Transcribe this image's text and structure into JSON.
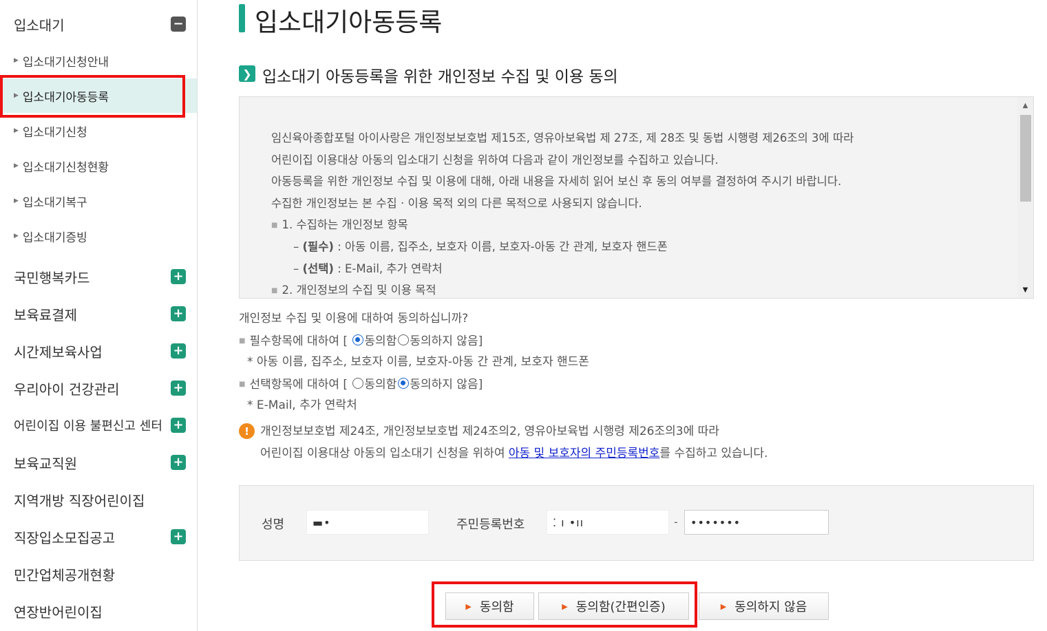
{
  "sidebar": {
    "waitlist": {
      "header": "입소대기",
      "items": [
        "입소대기신청안내",
        "입소대기아동등록",
        "입소대기신청",
        "입소대기신청현황",
        "입소대기복구",
        "입소대기증빙"
      ]
    },
    "sections": [
      {
        "label": "국민행복카드",
        "toggle": "+"
      },
      {
        "label": "보육료결제",
        "toggle": "+"
      },
      {
        "label": "시간제보육사업",
        "toggle": "+"
      },
      {
        "label": "우리아이 건강관리",
        "toggle": "+"
      },
      {
        "label": "어린이집 이용 불편신고 센터",
        "toggle": "+"
      },
      {
        "label": "보육교직원",
        "toggle": "+"
      },
      {
        "label": "지역개방 직장어린이집",
        "toggle": ""
      },
      {
        "label": "직장입소모집공고",
        "toggle": "+"
      },
      {
        "label": "민간업체공개현황",
        "toggle": ""
      },
      {
        "label": "연장반어린이집",
        "toggle": ""
      }
    ],
    "minus_toggle": "−"
  },
  "main": {
    "page_title": "입소대기아동등록",
    "section_title": "입소대기 아동등록을 위한 개인정보 수집 및 이용 동의",
    "agreement_lines": [
      "임신육아종합포털 아이사랑은 개인정보보호법 제15조, 영유아보육법 제 27조, 제 28조 및 동법 시행령 제26조의 3에 따라",
      "어린이집 이용대상 아동의 입소대기 신청을 위하여 다음과 같이 개인정보를 수집하고 있습니다.",
      "아동등록을 위한 개인정보 수집 및 이용에 대해, 아래 내용을 자세히 읽어 보신 후 동의 여부를 결정하여 주시기 바랍니다.",
      "수집한 개인정보는 본 수집 · 이용 목적 외의 다른 목적으로 사용되지 않습니다."
    ],
    "agreement_item1": "1. 수집하는 개인정보 항목",
    "agreement_required_tag": "(필수)",
    "agreement_required_text": " : 아동 이름, 집주소, 보호자 이름, 보호자-아동 간 관계, 보호자 핸드폰",
    "agreement_optional_tag": "(선택)",
    "agreement_optional_text": " : E-Mail, 추가 연락처",
    "agreement_item2": "2. 개인정보의 수집 및 이용 목적",
    "consent_question": "개인정보 수집 및 이용에 대하여 동의하십니까?",
    "required_label": "필수항목에 대하여 [",
    "optional_label": "선택항목에 대하여 [",
    "agree_label": "동의함",
    "disagree_label": "동의하지 않음]",
    "required_note": "* 아동 이름, 집주소, 보호자 이름, 보호자-아동 간 관계, 보호자 핸드폰",
    "optional_note": "* E-Mail, 추가 연락처",
    "notice_line1": "개인정보보호법 제24조, 개인정보보호법 제24조의2, 영유아보육법 시행령 제26조의3에 따라",
    "notice_line2_pre": "어린이집 이용대상 아동의 입소대기 신청을 위하여 ",
    "notice_link": "아동 및 보호자의 주민등록번호",
    "notice_line2_post": "를 수집하고 있습니다.",
    "form": {
      "name_label": "성명",
      "name_value": "▬•",
      "rrn_label": "주민등록번호",
      "rrn_front": "⁚ ı •ıı",
      "rrn_dash": "-",
      "rrn_back": "•••••••"
    },
    "buttons": {
      "agree": "동의함",
      "agree_simple": "동의함(간편인증)",
      "disagree": "동의하지 않음"
    }
  }
}
